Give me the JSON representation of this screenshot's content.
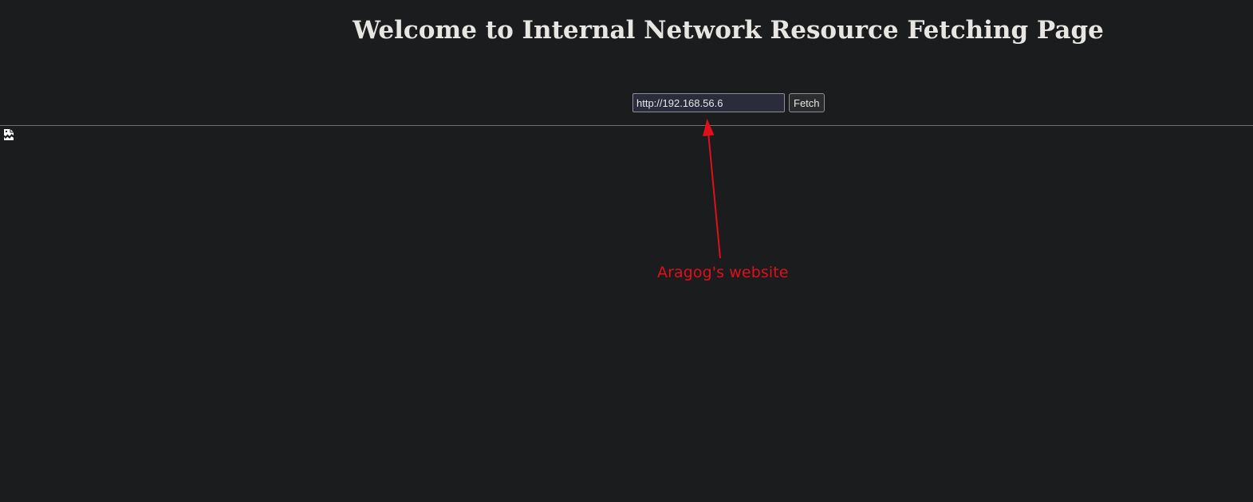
{
  "page": {
    "title": "Welcome to Internal Network Resource Fetching Page"
  },
  "fetch_form": {
    "url_value": "http://192.168.56.6",
    "button_label": "Fetch"
  },
  "content": {
    "broken_image_icon": "broken-image-icon"
  },
  "annotation": {
    "label": "Aragog's website",
    "color": "#e0101a"
  },
  "theme": {
    "background": "#1b1c1e",
    "text": "#e8e6e3"
  }
}
